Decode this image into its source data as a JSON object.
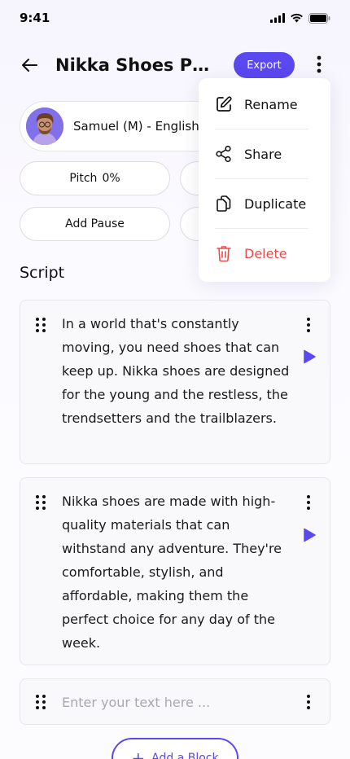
{
  "status_bar": {
    "time": "9:41"
  },
  "header": {
    "title": "Nikka Shoes Pro...",
    "export_label": "Export"
  },
  "voice": {
    "name": "Samuel (M) - English"
  },
  "controls": {
    "pitch_label": "Pitch",
    "pitch_value": "0%",
    "add_pause_label": "Add Pause"
  },
  "script": {
    "title": "Script",
    "blocks": [
      {
        "text": "In a world that's constantly moving, you need shoes that can keep up. Nikka shoes are designed for the young and the restless, the trendsetters and the trailblazers."
      },
      {
        "text": "Nikka shoes are made with high-quality materials that can withstand any adventure. They're comfortable, stylish, and affordable, making them the perfect choice for any day of the week."
      }
    ],
    "input_placeholder": "Enter your text here ...",
    "add_block_label": "Add a Block"
  },
  "menu": {
    "items": [
      {
        "label": "Rename",
        "icon": "edit-icon"
      },
      {
        "label": "Share",
        "icon": "share-icon"
      },
      {
        "label": "Duplicate",
        "icon": "duplicate-icon"
      },
      {
        "label": "Delete",
        "icon": "trash-icon"
      }
    ]
  },
  "colors": {
    "accent": "#5a48f0",
    "danger": "#e84d4d"
  }
}
